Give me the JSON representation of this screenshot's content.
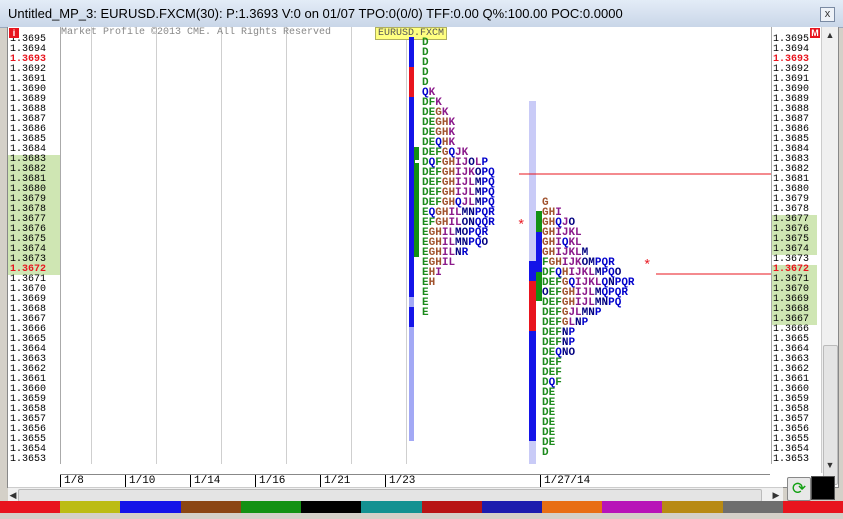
{
  "window": {
    "title": "Untitled_MP_3: EURUSD.FXCM(30): P:1.3693 V:0 on 01/07 TPO:0(0/0) TFF:0.00 Q%:100.00 POC:0.0000",
    "close_glyph": "x"
  },
  "chart": {
    "watermark": "Market Profile ©2013 CME. All Rights Reserved",
    "symbol": "EURUSD.FXCM",
    "left_badge": "i",
    "right_badge": "M",
    "price_labels": [
      "1.3695",
      "1.3694",
      "1.3693",
      "1.3692",
      "1.3691",
      "1.3690",
      "1.3689",
      "1.3688",
      "1.3687",
      "1.3686",
      "1.3685",
      "1.3684",
      "1.3683",
      "1.3682",
      "1.3681",
      "1.3680",
      "1.3679",
      "1.3678",
      "1.3677",
      "1.3676",
      "1.3675",
      "1.3674",
      "1.3673",
      "1.3672",
      "1.3671",
      "1.3670",
      "1.3669",
      "1.3668",
      "1.3667",
      "1.3666",
      "1.3665",
      "1.3664",
      "1.3663",
      "1.3662",
      "1.3661",
      "1.3660",
      "1.3659",
      "1.3658",
      "1.3657",
      "1.3656",
      "1.3655",
      "1.3654",
      "1.3653"
    ],
    "left_highlight": [
      "1.3683",
      "1.3682",
      "1.3681",
      "1.3680",
      "1.3679",
      "1.3678",
      "1.3677",
      "1.3676",
      "1.3675",
      "1.3674",
      "1.3673"
    ],
    "right_highlight": [
      "1.3677",
      "1.3676",
      "1.3675",
      "1.3674",
      "1.3671",
      "1.3670",
      "1.3669",
      "1.3668",
      "1.3667"
    ],
    "red_prices": [
      "1.3693",
      "1.3672"
    ],
    "x_labels": [
      "1/8",
      "1/10",
      "1/14",
      "1/16",
      "1/21",
      "1/23",
      "1/27/14"
    ],
    "profile1": [
      "D",
      "D",
      "D",
      "D",
      "D",
      "QK",
      "DFK",
      "DEGK",
      "DEGHK",
      "DEGHK",
      "DEQHK",
      "DEFGQJK",
      "DQFGHIJOLP",
      "DEFGHIJKOPQ",
      "DEFGHIJLMPQ",
      "DEFGHIJLMPQ",
      "DEFGHQJLMPQ",
      "EQGHILMNPQR",
      "EFGHILONQQR",
      "EGHILMOPQR",
      "EGHILMNPQO",
      "EGHILNR",
      "EGHIL",
      "EHI",
      "EH",
      "E",
      "E",
      "E"
    ],
    "profile2": [
      "G",
      "GHI",
      "GHQJO",
      "GHIJKL",
      "GHIQKL",
      "GHIJKLM",
      "FGHIJKOMPQR",
      "DFQHIJKLMPQO",
      "DEFGQIJKLQNPQR",
      "OEFGHIJLMQPQR",
      "DEFGHIJLMNPQ",
      "DEFGJLMNP",
      "DEFGLNP",
      "DEFNP",
      "DEFNP",
      "DEQNO",
      "DEF",
      "DEF",
      "DQF",
      "DE",
      "DE",
      "DE",
      "DE",
      "DE",
      "DE",
      "D"
    ],
    "poc_marker": "*",
    "period_colors": {
      "D": "#1c8a1c",
      "E": "#1c8a1c",
      "F": "#1c8a1c",
      "G": "#a0522d",
      "H": "#a0522d",
      "I": "#8b1a8b",
      "J": "#8b1a8b",
      "K": "#8b1a8b",
      "L": "#8b1a8b",
      "M": "#000080",
      "N": "#000080",
      "O": "#000080",
      "P": "#0000cc",
      "Q": "#0000cc",
      "R": "#0000cc"
    },
    "palette": [
      "#e8141e",
      "#bcbc14",
      "#1414e8",
      "#8b4513",
      "#139113",
      "#000000",
      "#139191",
      "#b81414",
      "#1c1cae",
      "#e86e14",
      "#b814b8",
      "#b88a14",
      "#6e6e6e",
      "#e8141e"
    ]
  },
  "refresh_glyph": "⟳"
}
